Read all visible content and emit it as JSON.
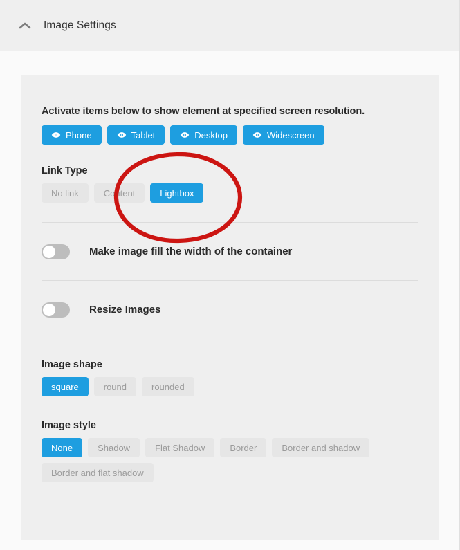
{
  "header": {
    "title": "Image Settings",
    "collapse_icon": "chevron-up-icon"
  },
  "main": {
    "resolution": {
      "lead_text": "Activate items below to show element at specified screen resolution.",
      "buttons": [
        {
          "label": "Phone",
          "icon": "eye-icon",
          "state": "active"
        },
        {
          "label": "Tablet",
          "icon": "eye-icon",
          "state": "active"
        },
        {
          "label": "Desktop",
          "icon": "eye-icon",
          "state": "active"
        },
        {
          "label": "Widescreen",
          "icon": "eye-icon",
          "state": "active"
        }
      ]
    },
    "link_type": {
      "label": "Link Type",
      "options": [
        {
          "label": "No link",
          "state": "inactive"
        },
        {
          "label": "Content",
          "state": "inactive"
        },
        {
          "label": "Lightbox",
          "state": "active"
        }
      ],
      "selected": "Lightbox"
    },
    "fill_width": {
      "label": "Make image fill the width of the container",
      "value": "off"
    },
    "resize_images": {
      "label": "Resize Images",
      "value": "off"
    },
    "image_shape": {
      "label": "Image shape",
      "options": [
        {
          "label": "square",
          "state": "active"
        },
        {
          "label": "round",
          "state": "inactive"
        },
        {
          "label": "rounded",
          "state": "inactive"
        }
      ],
      "selected": "square"
    },
    "image_style": {
      "label": "Image style",
      "options": [
        {
          "label": "None",
          "state": "active"
        },
        {
          "label": "Shadow",
          "state": "inactive"
        },
        {
          "label": "Flat Shadow",
          "state": "inactive"
        },
        {
          "label": "Border",
          "state": "inactive"
        },
        {
          "label": "Border and shadow",
          "state": "inactive"
        },
        {
          "label": "Border and flat shadow",
          "state": "inactive"
        }
      ],
      "selected": "None"
    }
  },
  "annotation": {
    "shape": "red-ellipse-highlight",
    "color": "#CC1512",
    "targets": "Lightbox"
  },
  "colors": {
    "accent_blue": "#1E9EE0",
    "inactive_grey": "#E6E6E6",
    "inactive_text": "#9B9B9B",
    "card_bg": "#EFEFEF",
    "page_bg": "#FAFAFA",
    "annotation_red": "#CC1512"
  }
}
